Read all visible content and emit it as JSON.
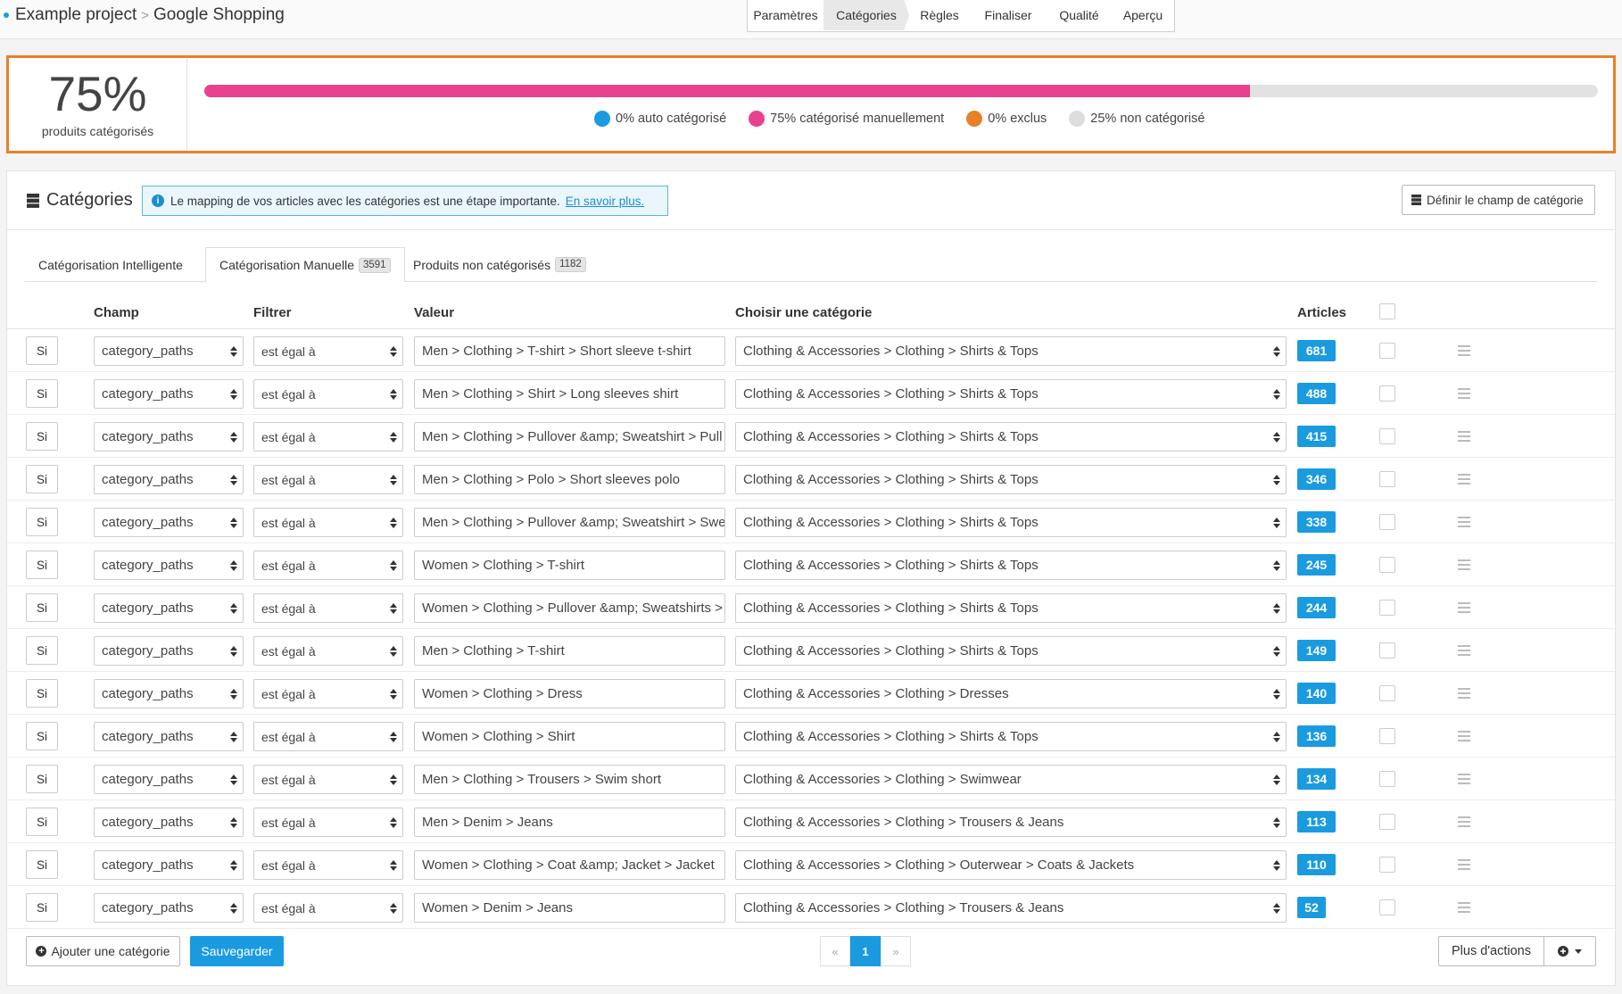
{
  "breadcrumb": {
    "project": "Example project",
    "separator": ">",
    "channel": "Google Shopping"
  },
  "steps": [
    "Paramètres",
    "Catégories",
    "Règles",
    "Finaliser",
    "Qualité",
    "Aperçu"
  ],
  "active_step": "Catégories",
  "progress": {
    "percent_label": "75%",
    "sub_label": "produits catégorisés",
    "fill_fraction": 0.75,
    "legend": [
      {
        "label": "0% auto catégorisé",
        "color": "#1a9be0"
      },
      {
        "label": "75% catégorisé manuellement",
        "color": "#e8418f"
      },
      {
        "label": "0% exclus",
        "color": "#e8802a"
      },
      {
        "label": "25% non catégorisé",
        "color": "#dddddd"
      }
    ]
  },
  "categories_panel": {
    "title": "Catégories",
    "info_text": "Le mapping de vos articles avec les catégories est une étape importante.",
    "info_link": "En savoir plus.",
    "define_button": "Définir le champ de catégorie"
  },
  "tabs": [
    {
      "label": "Catégorisation Intelligente",
      "count": ""
    },
    {
      "label": "Catégorisation Manuelle",
      "count": "3591"
    },
    {
      "label": "Produits non catégorisés",
      "count": "1182"
    }
  ],
  "columns": {
    "champ": "Champ",
    "filtrer": "Filtrer",
    "valeur": "Valeur",
    "categorie": "Choisir une catégorie",
    "articles": "Articles"
  },
  "rows": [
    {
      "si": "Si",
      "champ": "category_paths",
      "filtre": "est égal à",
      "valeur": "Men > Clothing > T-shirt > Short sleeve t-shirt",
      "categorie": "Clothing & Accessories > Clothing > Shirts & Tops",
      "articles": "681"
    },
    {
      "si": "Si",
      "champ": "category_paths",
      "filtre": "est égal à",
      "valeur": "Men > Clothing > Shirt > Long sleeves shirt",
      "categorie": "Clothing & Accessories > Clothing > Shirts & Tops",
      "articles": "488"
    },
    {
      "si": "Si",
      "champ": "category_paths",
      "filtre": "est égal à",
      "valeur": "Men > Clothing > Pullover &amp; Sweatshirt > Pull",
      "categorie": "Clothing & Accessories > Clothing > Shirts & Tops",
      "articles": "415"
    },
    {
      "si": "Si",
      "champ": "category_paths",
      "filtre": "est égal à",
      "valeur": "Men > Clothing > Polo > Short sleeves polo",
      "categorie": "Clothing & Accessories > Clothing > Shirts & Tops",
      "articles": "346"
    },
    {
      "si": "Si",
      "champ": "category_paths",
      "filtre": "est égal à",
      "valeur": "Men > Clothing > Pullover &amp; Sweatshirt > Swe",
      "categorie": "Clothing & Accessories > Clothing > Shirts & Tops",
      "articles": "338"
    },
    {
      "si": "Si",
      "champ": "category_paths",
      "filtre": "est égal à",
      "valeur": "Women > Clothing > T-shirt",
      "categorie": "Clothing & Accessories > Clothing > Shirts & Tops",
      "articles": "245"
    },
    {
      "si": "Si",
      "champ": "category_paths",
      "filtre": "est égal à",
      "valeur": "Women > Clothing > Pullover &amp; Sweatshirts >",
      "categorie": "Clothing & Accessories > Clothing > Shirts & Tops",
      "articles": "244"
    },
    {
      "si": "Si",
      "champ": "category_paths",
      "filtre": "est égal à",
      "valeur": "Men > Clothing > T-shirt",
      "categorie": "Clothing & Accessories > Clothing > Shirts & Tops",
      "articles": "149"
    },
    {
      "si": "Si",
      "champ": "category_paths",
      "filtre": "est égal à",
      "valeur": "Women > Clothing > Dress",
      "categorie": "Clothing & Accessories > Clothing > Dresses",
      "articles": "140"
    },
    {
      "si": "Si",
      "champ": "category_paths",
      "filtre": "est égal à",
      "valeur": "Women > Clothing > Shirt",
      "categorie": "Clothing & Accessories > Clothing > Shirts & Tops",
      "articles": "136"
    },
    {
      "si": "Si",
      "champ": "category_paths",
      "filtre": "est égal à",
      "valeur": "Men > Clothing > Trousers > Swim short",
      "categorie": "Clothing & Accessories > Clothing > Swimwear",
      "articles": "134"
    },
    {
      "si": "Si",
      "champ": "category_paths",
      "filtre": "est égal à",
      "valeur": "Men > Denim > Jeans",
      "categorie": "Clothing & Accessories > Clothing > Trousers & Jeans",
      "articles": "113"
    },
    {
      "si": "Si",
      "champ": "category_paths",
      "filtre": "est égal à",
      "valeur": "Women > Clothing > Coat &amp; Jacket > Jacket",
      "categorie": "Clothing & Accessories > Clothing > Outerwear > Coats & Jackets",
      "articles": "110"
    },
    {
      "si": "Si",
      "champ": "category_paths",
      "filtre": "est égal à",
      "valeur": "Women > Denim > Jeans",
      "categorie": "Clothing & Accessories > Clothing > Trousers & Jeans",
      "articles": "52"
    }
  ],
  "footer": {
    "add_button": "Ajouter une catégorie",
    "save_button": "Sauvegarder",
    "pager": {
      "prev": "«",
      "current": "1",
      "next": "»"
    },
    "more_actions": "Plus d'actions"
  },
  "colors": {
    "accent": "#1a9be0",
    "highlight_border": "#e8802a",
    "manual": "#e8418f"
  }
}
